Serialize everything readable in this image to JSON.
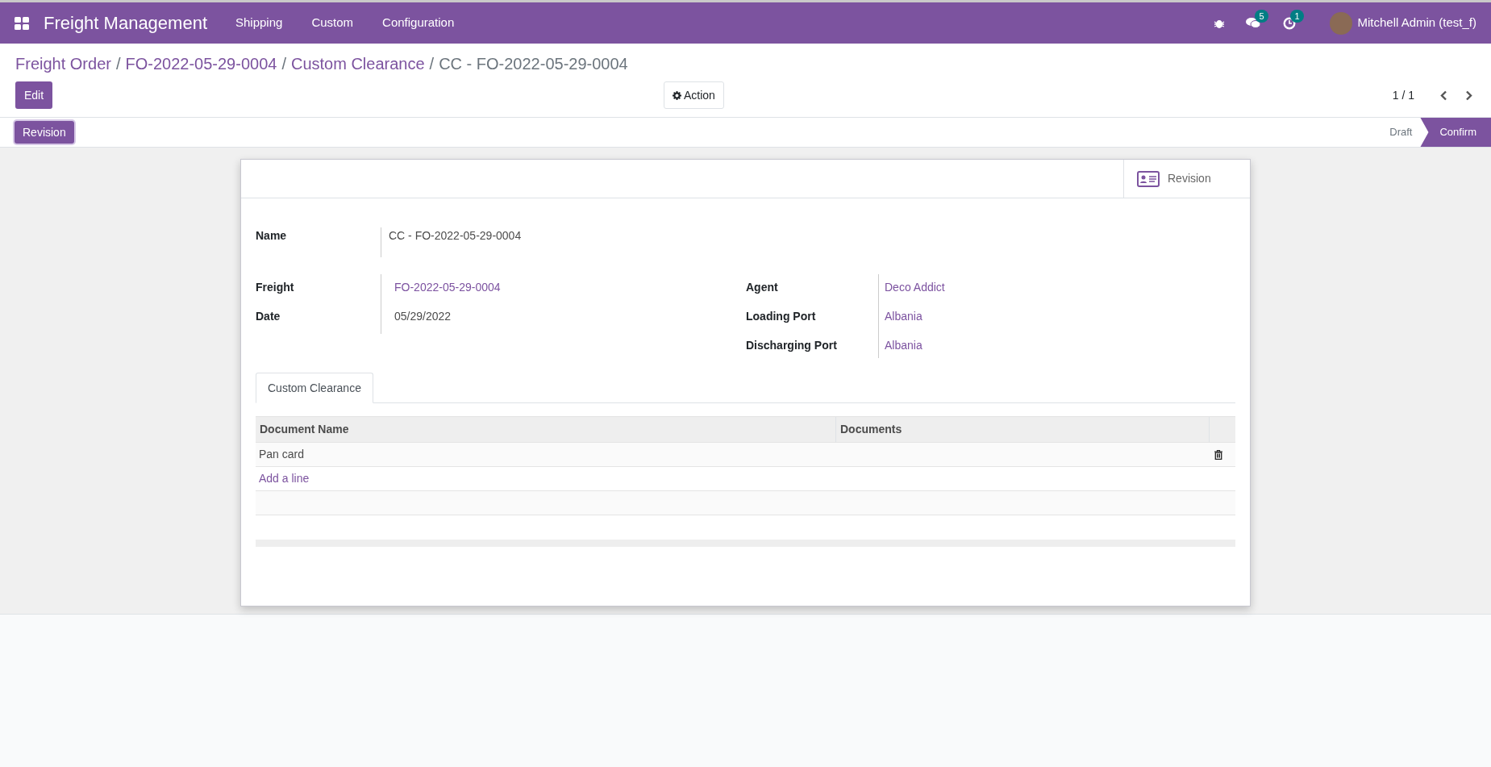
{
  "navbar": {
    "app_name": "Freight Management",
    "menus": [
      "Shipping",
      "Custom",
      "Configuration"
    ],
    "messages_count": "5",
    "activities_count": "1",
    "user": "Mitchell Admin (test_f)"
  },
  "breadcrumb": {
    "separator": "/",
    "links": [
      "Freight Order",
      "FO-2022-05-29-0004",
      "Custom Clearance"
    ],
    "current": "CC - FO-2022-05-29-0004"
  },
  "control_panel": {
    "edit": "Edit",
    "action": "Action",
    "pager": "1 / 1"
  },
  "header_buttons": [
    "Revision"
  ],
  "stages": [
    {
      "label": "Draft",
      "selected": false
    },
    {
      "label": "Confirm",
      "selected": true
    }
  ],
  "smart_button": "Revision",
  "name_field": {
    "label": "Name",
    "value": "CC - FO-2022-05-29-0004"
  },
  "left_fields": [
    {
      "label": "Freight",
      "value": "FO-2022-05-29-0004",
      "kind": "link"
    },
    {
      "label": "Date",
      "value": "05/29/2022",
      "kind": "text"
    }
  ],
  "right_fields": [
    {
      "label": "Agent",
      "value": "Deco Addict",
      "kind": "link"
    },
    {
      "label": "Loading Port",
      "value": "Albania",
      "kind": "link"
    },
    {
      "label": "Discharging Port",
      "value": "Albania",
      "kind": "link"
    }
  ],
  "tabs": [
    {
      "label": "Custom Clearance",
      "selected": true
    }
  ],
  "table": {
    "columns": [
      "Document Name",
      "Documents"
    ],
    "rows": [
      {
        "document_name": "Pan card"
      }
    ],
    "add_line": "Add a line"
  }
}
